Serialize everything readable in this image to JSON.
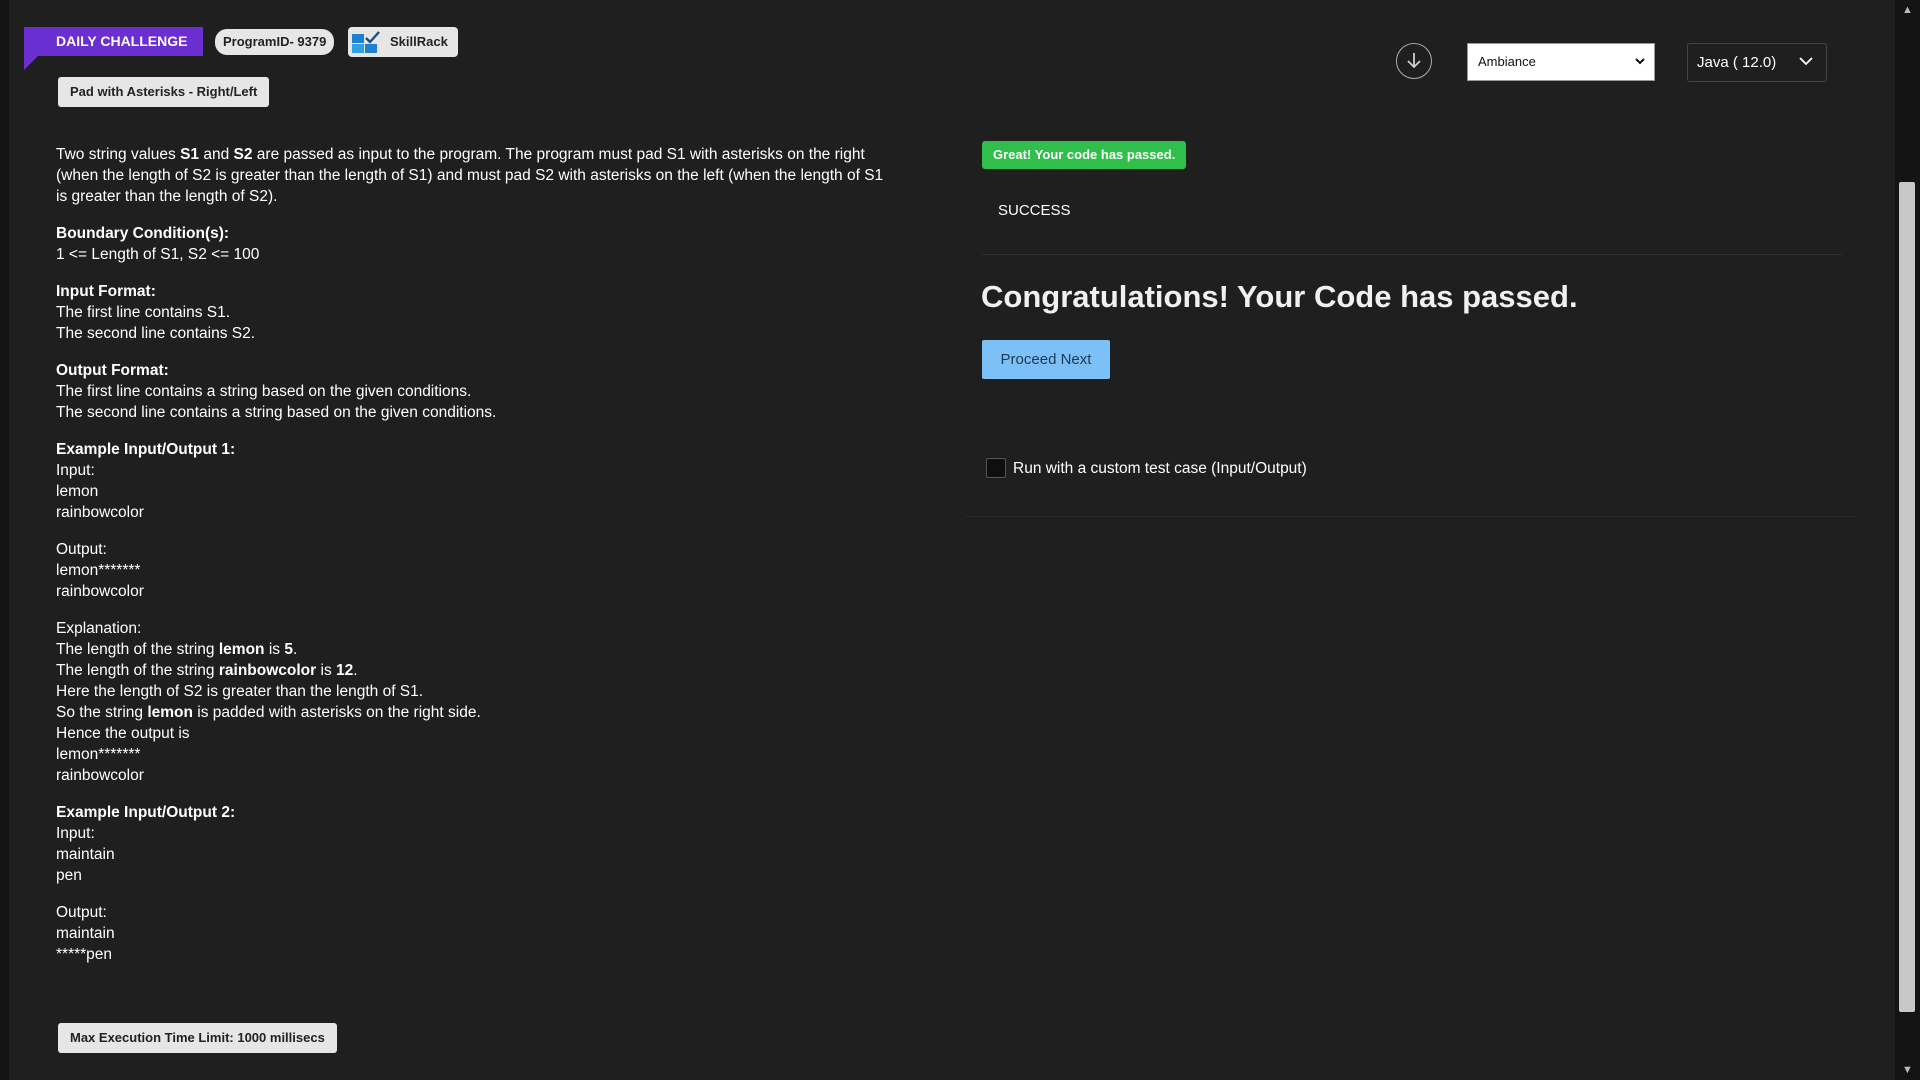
{
  "header": {
    "daily_challenge": "DAILY CHALLENGE",
    "program_id": "ProgramID- 9379",
    "brand": "SkillRack",
    "problem_title": "Pad with Asterisks - Right/Left"
  },
  "controls": {
    "download_icon": "download-arrow-icon",
    "theme_selected": "Ambiance",
    "language_selected": "Java ( 12.0)"
  },
  "description": {
    "intro": [
      {
        "t": "Two string values ",
        "b": false
      },
      {
        "t": "S1",
        "b": true
      },
      {
        "t": " and ",
        "b": false
      },
      {
        "t": "S2",
        "b": true
      },
      {
        "t": " are passed as input to the program. The program must pad S1 with asterisks on the right",
        "b": false
      }
    ],
    "intro_line2": "(when the length of S2 is greater than the length of S1) and must pad S2 with asterisks on the left (when the length of S1",
    "intro_line3": "is greater than the length of S2).",
    "boundary_heading": "Boundary Condition(s):",
    "boundary_text": "1 <= Length of S1, S2 <= 100",
    "input_heading": "Input Format:",
    "input_line1": "The first line contains S1.",
    "input_line2": "The second line contains S2.",
    "output_heading": "Output Format:",
    "output_line1": "The first line contains a string based on the given conditions.",
    "output_line2": "The second line contains a string based on the given conditions.",
    "ex1_heading": "Example Input/Output 1:",
    "ex1_input_label": "Input:",
    "ex1_input_1": "lemon",
    "ex1_input_2": "rainbowcolor",
    "ex1_output_label": "Output:",
    "ex1_output_1": "lemon*******",
    "ex1_output_2": "rainbowcolor",
    "explanation_label": "Explanation:",
    "exp1_a": "The length of the string ",
    "exp1_b": "lemon",
    "exp1_c": " is ",
    "exp1_d": "5",
    "exp1_e": ".",
    "exp2_a": "The length of the string ",
    "exp2_b": "rainbowcolor",
    "exp2_c": " is ",
    "exp2_d": "12",
    "exp2_e": ".",
    "exp3": "Here the length of S2 is greater than the length of S1.",
    "exp4_a": "So the string ",
    "exp4_b": "lemon",
    "exp4_c": " is padded with asterisks on the right side.",
    "exp5": "Hence the output is",
    "exp6": "lemon*******",
    "exp7": "rainbowcolor",
    "ex2_heading": "Example Input/Output 2:",
    "ex2_input_label": "Input:",
    "ex2_input_1": "maintain",
    "ex2_input_2": "pen",
    "ex2_output_label": "Output:",
    "ex2_output_1": "maintain",
    "ex2_output_2": "*****pen"
  },
  "footer": {
    "max_exec": "Max Execution Time Limit: 1000 millisecs"
  },
  "result": {
    "badge": "Great! Your code has passed.",
    "status": "SUCCESS",
    "congrats": "Congratulations! Your Code has passed.",
    "proceed": "Proceed Next",
    "custom_label": "Run with a custom test case (Input/Output)"
  },
  "colors": {
    "accent_purple": "#6a2ed1",
    "success_green": "#2fbf4a",
    "proceed_blue": "#7cc0f5"
  }
}
